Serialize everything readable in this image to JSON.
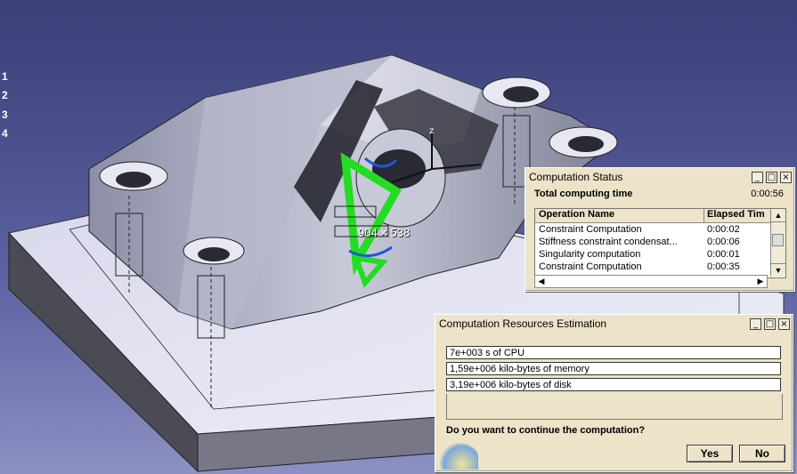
{
  "left_index": [
    "1",
    "2",
    "3",
    "4"
  ],
  "viewport": {
    "overlay_label": "904 × 538"
  },
  "computation_status": {
    "title": "Computation Status",
    "controls": {
      "minimize": "_",
      "maximize": "□",
      "close": "×"
    },
    "total_label": "Total computing time",
    "total_value": "0:00:56",
    "columns": [
      "Operation Name",
      "Elapsed Tim"
    ],
    "rows": [
      {
        "name": "Constraint Computation",
        "time": "0:00:02"
      },
      {
        "name": "Stiffness constraint condensat...",
        "time": "0:00:06"
      },
      {
        "name": "Singularity computation",
        "time": "0:00:01"
      },
      {
        "name": "Constraint Computation",
        "time": "0:00:35"
      }
    ]
  },
  "resources": {
    "title": "Computation Resources Estimation",
    "controls": {
      "minimize": "_",
      "maximize": "□",
      "close": "×"
    },
    "cpu": "7e+003 s of CPU",
    "memory": "1,59e+006 kilo-bytes of memory",
    "disk": "3,19e+006 kilo-bytes of disk",
    "question": "Do you want to continue the computation?",
    "yes_label": "Yes",
    "no_label": "No"
  }
}
